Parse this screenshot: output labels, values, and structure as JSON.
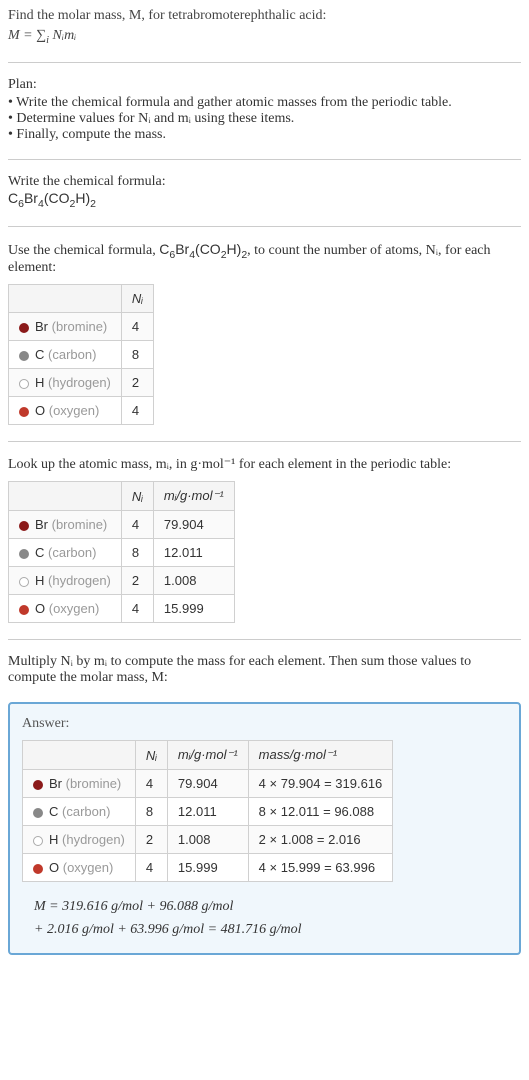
{
  "intro": {
    "line1": "Find the molar mass, M, for tetrabromoterephthalic acid:",
    "formula": "M = ∑",
    "formula_sub": "i",
    "formula_tail": " Nᵢmᵢ"
  },
  "plan": {
    "title": "Plan:",
    "items": [
      "Write the chemical formula and gather atomic masses from the periodic table.",
      "Determine values for Nᵢ and mᵢ using these items.",
      "Finally, compute the mass."
    ]
  },
  "write_formula": {
    "title": "Write the chemical formula:",
    "formula_c6": "C",
    "formula_6": "6",
    "formula_br": "Br",
    "formula_4": "4",
    "formula_open": "(CO",
    "formula_2": "2",
    "formula_h": "H)",
    "formula_end2": "2"
  },
  "count_text": {
    "prefix": "Use the chemical formula, ",
    "suffix": ", to count the number of atoms, Nᵢ, for each element:"
  },
  "elements": {
    "br": {
      "symbol": "Br",
      "name": "(bromine)",
      "n": "4",
      "m": "79.904",
      "mass": "4 × 79.904 = 319.616"
    },
    "c": {
      "symbol": "C",
      "name": "(carbon)",
      "n": "8",
      "m": "12.011",
      "mass": "8 × 12.011 = 96.088"
    },
    "h": {
      "symbol": "H",
      "name": "(hydrogen)",
      "n": "2",
      "m": "1.008",
      "mass": "2 × 1.008 = 2.016"
    },
    "o": {
      "symbol": "O",
      "name": "(oxygen)",
      "n": "4",
      "m": "15.999",
      "mass": "4 × 15.999 = 63.996"
    }
  },
  "headers": {
    "ni": "Nᵢ",
    "mi": "mᵢ/g·mol⁻¹",
    "mass": "mass/g·mol⁻¹"
  },
  "lookup_text": "Look up the atomic mass, mᵢ, in g·mol⁻¹ for each element in the periodic table:",
  "multiply_text": "Multiply Nᵢ by mᵢ to compute the mass for each element. Then sum those values to compute the molar mass, M:",
  "answer": {
    "title": "Answer:",
    "final1": "M = 319.616 g/mol + 96.088 g/mol",
    "final2": "+ 2.016 g/mol + 63.996 g/mol = 481.716 g/mol"
  }
}
